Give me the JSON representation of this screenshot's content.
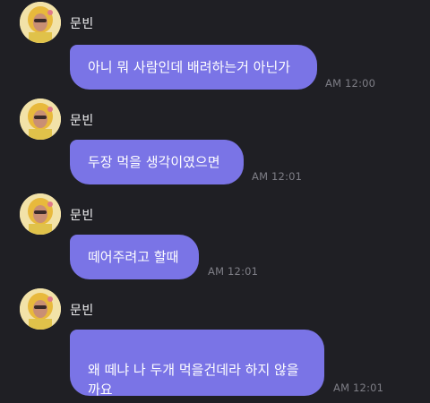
{
  "chat": {
    "messages": [
      {
        "sender": "문빈",
        "text": "아니 뭐 사람인데 배려하는거 아닌가",
        "time": "AM 12:00"
      },
      {
        "sender": "문빈",
        "text": "두장 먹을 생각이였으면",
        "time": "AM 12:01"
      },
      {
        "sender": "문빈",
        "text": "떼어주려고 할때",
        "time": "AM 12:01"
      },
      {
        "sender": "문빈",
        "text": "왜 떼냐 나 두개 먹을건데라 하지 않을\n까요",
        "time": "AM 12:01"
      }
    ],
    "colors": {
      "background": "#1f1f24",
      "bubble": "#7a74e6",
      "time": "#7e7e86"
    }
  }
}
